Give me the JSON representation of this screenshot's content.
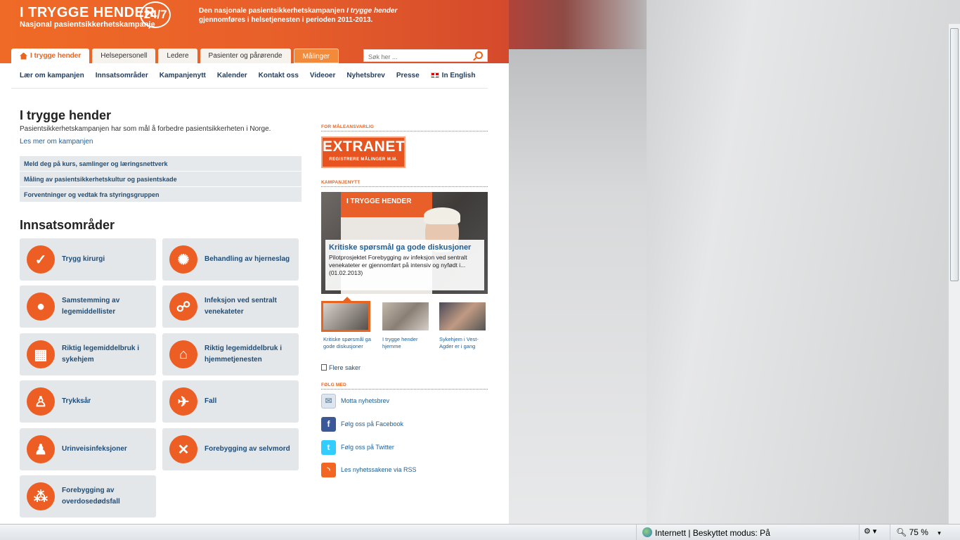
{
  "header": {
    "logo_title": "I TRYGGE HENDER",
    "logo_badge": "24/7",
    "logo_subtitle": "Nasjonal pasientsikkerhetskampanje",
    "intro_prefix": "Den nasjonale pasientsikkerhetskampanjen",
    "intro_em": "I trygge hender",
    "intro_suffix": "gjennomføres i helsetjenesten i perioden 2011-2013."
  },
  "tabs": [
    {
      "label": "I trygge hender"
    },
    {
      "label": "Helsepersonell"
    },
    {
      "label": "Ledere"
    },
    {
      "label": "Pasienter og pårørende"
    },
    {
      "label": "Målinger"
    }
  ],
  "search": {
    "placeholder": "Søk her ..."
  },
  "subnav": [
    {
      "label": "Lær om kampanjen"
    },
    {
      "label": "Innsatsområder"
    },
    {
      "label": "Kampanjenytt"
    },
    {
      "label": "Kalender"
    },
    {
      "label": "Kontakt oss"
    },
    {
      "label": "Videoer"
    },
    {
      "label": "Nyhetsbrev"
    },
    {
      "label": "Presse"
    },
    {
      "label": "In English"
    }
  ],
  "main": {
    "title": "I trygge hender",
    "description": "Pasientsikkerhetskampanjen har som mål å forbedre pasientsikkerheten i Norge.",
    "more_link": "Les mer om kampanjen",
    "links": [
      "Meld deg på kurs, samlinger og læringsnettverk",
      "Måling av pasientsikkerhetskultur og pasientskade",
      "Forventninger og vedtak fra styringsgruppen"
    ],
    "areas_title": "Innsatsområder",
    "areas": [
      {
        "label": "Trygg kirurgi",
        "icon": "checkmark-icon"
      },
      {
        "label": "Behandling av hjerneslag",
        "icon": "brain-icon"
      },
      {
        "label": "Samstemming av legemiddellister",
        "icon": "pills-icon"
      },
      {
        "label": "Infeksjon ved sentralt venekateter",
        "icon": "catheter-icon"
      },
      {
        "label": "Riktig legemiddelbruk i sykehjem",
        "icon": "nursing-home-icon"
      },
      {
        "label": "Riktig legemiddelbruk i hjemmetjenesten",
        "icon": "house-icon"
      },
      {
        "label": "Trykksår",
        "icon": "pressure-ulcer-icon"
      },
      {
        "label": "Fall",
        "icon": "falling-person-icon"
      },
      {
        "label": "Urinveisinfeksjoner",
        "icon": "urinary-icon"
      },
      {
        "label": "Forebygging av selvmord",
        "icon": "person-distress-icon"
      },
      {
        "label": "Forebygging av overdosedødsfall",
        "icon": "overdose-icon"
      }
    ]
  },
  "sidebar": {
    "measure_heading": "FOR MÅLEANSVARLIG",
    "extranet_title": "EXTRANET",
    "extranet_sub": "REGISTRERE MÅLINGER M.M.",
    "news_heading": "KAMPANJENYTT",
    "hero_banner": "I TRYGGE HENDER",
    "hero_title": "Kritiske spørsmål ga gode diskusjoner",
    "hero_text": "Pilotprosjektet Forebygging av infeksjon ved sentralt venekateter er gjennomført på intensiv og nyfødt i...  (01.02.2013)",
    "thumbs": [
      {
        "caption": "Kritiske spørsmål ga gode diskusjoner"
      },
      {
        "caption": "I trygge hender hjemme"
      },
      {
        "caption": "Sykehjem i Vest-Agder er i gang"
      }
    ],
    "more_news": "Flere saker",
    "follow_heading": "FØLG MED",
    "follow": [
      {
        "label": "Motta nyhetsbrev",
        "icon": "envelope-icon",
        "color": "#dde6ee"
      },
      {
        "label": "Følg oss på Facebook",
        "icon": "facebook-icon",
        "color": "#3b5998"
      },
      {
        "label": "Følg oss på Twitter",
        "icon": "twitter-icon",
        "color": "#33ccff"
      },
      {
        "label": "Les nyhetssakene via RSS",
        "icon": "rss-icon",
        "color": "#f26522"
      }
    ]
  },
  "statusbar": {
    "zone": "Internett | Beskyttet modus: På",
    "zoom": "75 %"
  },
  "colors": {
    "accent": "#e8641f",
    "link": "#1e4d78"
  }
}
